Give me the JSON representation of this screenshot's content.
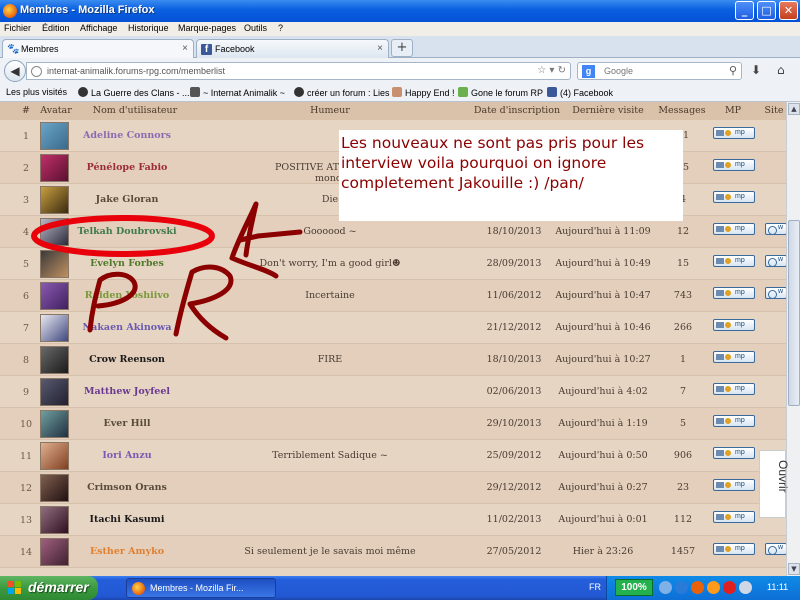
{
  "window": {
    "title": "Membres - Mozilla Firefox",
    "minimize": "_",
    "maximize": "□",
    "close": "✕"
  },
  "menu": [
    "Fichier",
    "Édition",
    "Affichage",
    "Historique",
    "Marque-pages",
    "Outils",
    "?"
  ],
  "tabs": [
    {
      "label": "Membres",
      "close": "×"
    },
    {
      "label": "Facebook",
      "close": "×"
    }
  ],
  "new_tab": "+",
  "nav": {
    "url": "internat-animalik.forums-rpg.com/memberlist",
    "search_placeholder": "Google",
    "search_engine_letter": "g"
  },
  "bookmarks": [
    "Les plus visités",
    "La Guerre des Clans - ...",
    "~ Internat Animalik ~",
    "créer un forum : Lies",
    "Happy End !",
    "Gone le forum RP",
    "(4) Facebook"
  ],
  "table": {
    "headers": [
      "#",
      "Avatar",
      "Nom d'utilisateur",
      "Humeur",
      "Date d'inscription",
      "Dernière visite",
      "Messages",
      "MP",
      "Site"
    ],
    "mp_label": "mp",
    "site_label": "w",
    "rows": [
      {
        "num": "1",
        "name": "Adeline Connors",
        "name_color": "#8b6bb0",
        "mood": "",
        "date": "",
        "last": "",
        "msgs": "51",
        "site": false,
        "av": [
          "#6aa5c8",
          "#3a6a8a"
        ]
      },
      {
        "num": "2",
        "name": "Pénélope Fabio",
        "name_color": "#9c2d38",
        "mood": "POSITIVE ATTITUDE (",
        "date": "",
        "last": "",
        "msgs": "35",
        "site": false,
        "av": [
          "#c0306a",
          "#5a1030"
        ]
      },
      {
        "num": "3",
        "name": "Jake Gloran",
        "name_color": "#5a4a3a",
        "mood": "Die",
        "date": "",
        "last": "",
        "msgs": "4",
        "site": false,
        "av": [
          "#c8a040",
          "#3a2a10"
        ]
      },
      {
        "num": "4",
        "name": "Telkah Doubrovski",
        "name_color": "#3f7a4a",
        "mood": "Goooood ~",
        "date": "18/10/2013",
        "last": "Aujourd'hui à 11:09",
        "msgs": "12",
        "site": true,
        "av": [
          "#b8b8c8",
          "#2a2a3a"
        ]
      },
      {
        "num": "5",
        "name": "Evelyn Forbes",
        "name_color": "#4f7a2a",
        "mood": "Don't worry, I'm a good girl☻",
        "date": "28/09/2013",
        "last": "Aujourd'hui à 10:49",
        "msgs": "15",
        "site": true,
        "av": [
          "#3a3a3a",
          "#c09060"
        ]
      },
      {
        "num": "6",
        "name": "Raiden Yoshiivo",
        "name_color": "#7a9a3a",
        "mood": "Incertaine",
        "date": "11/06/2012",
        "last": "Aujourd'hui à 10:47",
        "msgs": "743",
        "site": true,
        "av": [
          "#8a5ab0",
          "#402060"
        ]
      },
      {
        "num": "7",
        "name": "Nakaen Akinowa",
        "name_color": "#6a5ab0",
        "mood": "",
        "date": "21/12/2012",
        "last": "Aujourd'hui à 10:46",
        "msgs": "266",
        "site": false,
        "av": [
          "#e8e8f0",
          "#404880"
        ]
      },
      {
        "num": "8",
        "name": "Crow Reenson",
        "name_color": "#1a1a1a",
        "mood": "FIRE",
        "date": "18/10/2013",
        "last": "Aujourd'hui à 10:27",
        "msgs": "1",
        "site": false,
        "av": [
          "#6a6a6a",
          "#1a1a1a"
        ]
      },
      {
        "num": "9",
        "name": "Matthew Joyfeel",
        "name_color": "#6a3a90",
        "mood": "",
        "date": "02/06/2013",
        "last": "Aujourd'hui à 4:02",
        "msgs": "7",
        "site": false,
        "av": [
          "#5a5a70",
          "#202030"
        ]
      },
      {
        "num": "10",
        "name": "Ever Hill",
        "name_color": "#5a4a3a",
        "mood": "",
        "date": "29/10/2013",
        "last": "Aujourd'hui à 1:19",
        "msgs": "5",
        "site": false,
        "av": [
          "#70a0a0",
          "#203040"
        ]
      },
      {
        "num": "11",
        "name": "Iori Anzu",
        "name_color": "#7a5ab0",
        "mood": "Terriblement Sadique ~",
        "date": "25/09/2012",
        "last": "Aujourd'hui à 0:50",
        "msgs": "906",
        "site": false,
        "av": [
          "#e0b090",
          "#804020"
        ]
      },
      {
        "num": "12",
        "name": "Crimson Orans",
        "name_color": "#5a4a3a",
        "mood": "",
        "date": "29/12/2012",
        "last": "Aujourd'hui à 0:27",
        "msgs": "23",
        "site": false,
        "av": [
          "#806050",
          "#201010"
        ]
      },
      {
        "num": "13",
        "name": "Itachi Kasumi",
        "name_color": "#1a1a1a",
        "mood": "",
        "date": "11/02/2013",
        "last": "Aujourd'hui à 0:01",
        "msgs": "112",
        "site": false,
        "av": [
          "#907080",
          "#301020"
        ]
      },
      {
        "num": "14",
        "name": "Esther Amyko",
        "name_color": "#e08030",
        "mood": "Si seulement je le savais moi même",
        "date": "27/05/2012",
        "last": "Hier à 23:26",
        "msgs": "1457",
        "site": true,
        "av": [
          "#a06080",
          "#402030"
        ]
      }
    ]
  },
  "annotation": {
    "note": "Les nouveaux ne sont pas pris pour les interview voila pourquoi on ignore completement Jakouille :) /pan/",
    "hidden_mood_fragment": "monc",
    "ink_color": "#8b0000",
    "circle_color": "#e8000a"
  },
  "ouvrir": "Ouvrir",
  "taskbar": {
    "start": "démarrer",
    "task": "Membres - Mozilla Fir...",
    "lang": "FR",
    "zoom": "100%",
    "clock": "11:11"
  }
}
